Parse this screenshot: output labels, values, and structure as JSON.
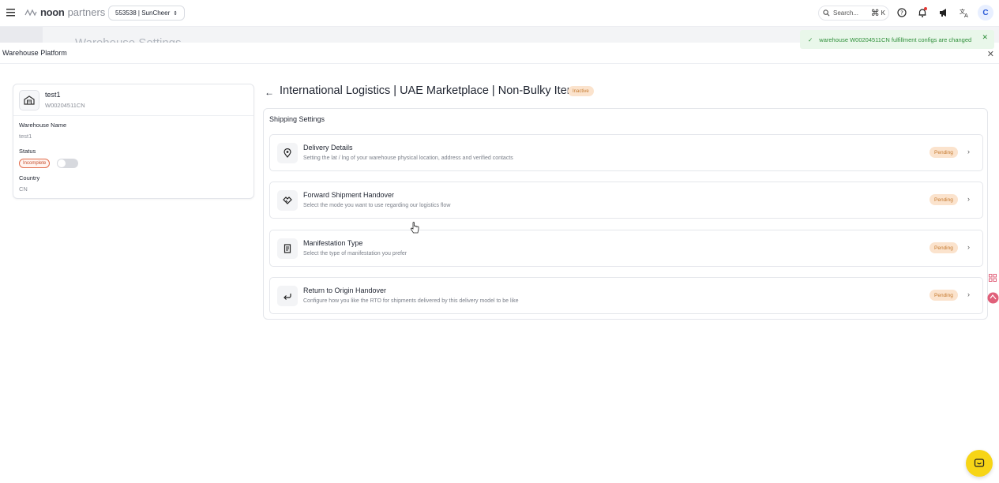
{
  "topbar": {
    "brand_bold": "noon",
    "brand_light": "partners",
    "store_label": "553538 | SunCheer",
    "search_placeholder": "Search...",
    "search_shortcut": "K",
    "avatar_initial": "C",
    "icons": [
      "menu-icon",
      "help-icon",
      "bell-icon",
      "megaphone-icon",
      "translate-icon"
    ]
  },
  "background": {
    "page_title": "Warehouse Settings"
  },
  "toast": {
    "message": "warehouse W00204511CN fulfillment configs are changed"
  },
  "panel": {
    "title": "Warehouse Platform"
  },
  "warehouse": {
    "name": "test1",
    "code": "W00204511CN",
    "fields": {
      "name_label": "Warehouse Name",
      "name_value": "test1",
      "status_label": "Status",
      "status_value": "Incomplete",
      "country_label": "Country",
      "country_value": "CN"
    },
    "toggle_on": false
  },
  "main": {
    "title": "International Logistics | UAE Marketplace | Non-Bulky Items",
    "status_badge": "Inactive",
    "section_title": "Shipping Settings",
    "rows": [
      {
        "title": "Delivery Details",
        "description": "Setting the lat / lng of your warehouse physical location, address and verified contacts",
        "status": "Pending",
        "icon": "location-pin-icon"
      },
      {
        "title": "Forward Shipment Handover",
        "description": "Select the mode you want to use regarding our logistics flow",
        "status": "Pending",
        "icon": "handshake-icon"
      },
      {
        "title": "Manifestation Type",
        "description": "Select the type of manifestation you prefer",
        "status": "Pending",
        "icon": "document-icon"
      },
      {
        "title": "Return to Origin Handover",
        "description": "Configure how you like the RTO for shipments delivered by this delivery model to be like",
        "status": "Pending",
        "icon": "return-arrow-icon"
      }
    ]
  },
  "colors": {
    "accent_green": "#2f8f3a",
    "pending_bg": "#fbe3cd",
    "pending_text": "#c57a2f",
    "incomplete_border": "#e26b4a",
    "chat_yellow": "#f7d516"
  }
}
